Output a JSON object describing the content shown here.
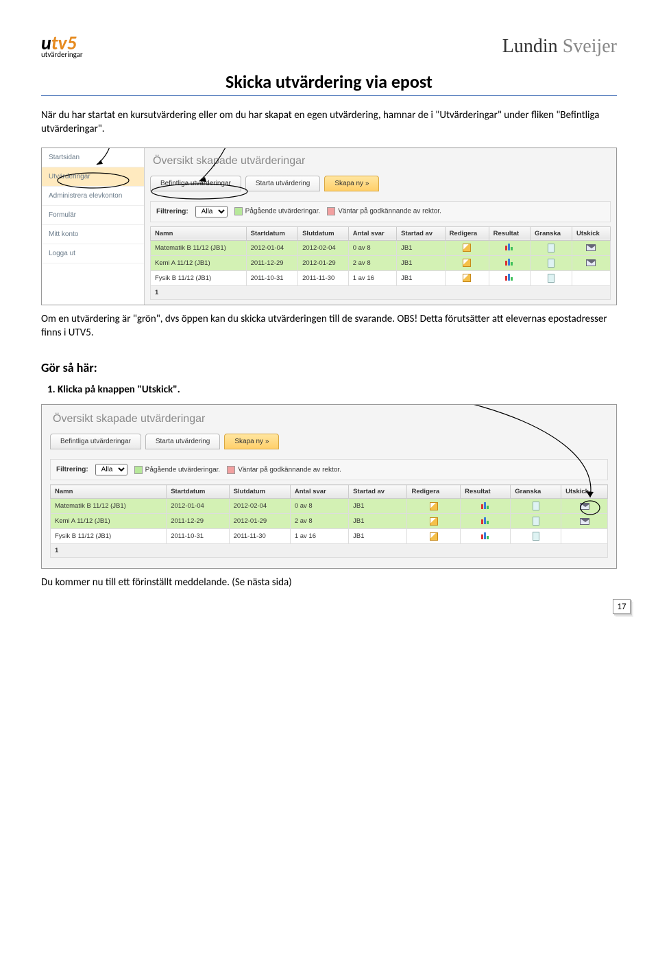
{
  "header": {
    "logo_left_u": "u",
    "logo_left_tv": "tv",
    "logo_left_5": "5",
    "logo_left_sub": "utvärderingar",
    "logo_right_a": "Lundin ",
    "logo_right_b": "Sveijer"
  },
  "title": "Skicka utvärdering via epost",
  "intro": "När du har startat en kursutvärdering eller om du har skapat en egen utvärdering, hamnar de i \"Utvärderingar\" under fliken \"Befintliga utvärderingar\".",
  "sidebar": {
    "items": [
      "Startsidan",
      "Utvärderingar",
      "Administrera elevkonton",
      "Formulär",
      "Mitt konto",
      "Logga ut"
    ]
  },
  "panel": {
    "title": "Översikt skapade utvärderingar",
    "tabs": {
      "t1": "Befintliga utvärderingar",
      "t2": "Starta utvärdering",
      "t3": "Skapa ny »"
    },
    "filter": {
      "label": "Filtrering:",
      "select": "Alla",
      "legend1": "Pågående utvärderingar.",
      "legend2": "Väntar på godkännande av rektor."
    },
    "columns": [
      "Namn",
      "Startdatum",
      "Slutdatum",
      "Antal svar",
      "Startad av",
      "Redigera",
      "Resultat",
      "Granska",
      "Utskick"
    ],
    "rows": [
      {
        "name": "Matematik B 11/12 (JB1)",
        "start": "2012-01-04",
        "end": "2012-02-04",
        "svar": "0 av 8",
        "av": "JB1",
        "green": true,
        "mail": true
      },
      {
        "name": "Kemi A 11/12 (JB1)",
        "start": "2011-12-29",
        "end": "2012-01-29",
        "svar": "2 av 8",
        "av": "JB1",
        "green": true,
        "mail": true
      },
      {
        "name": "Fysik B 11/12 (JB1)",
        "start": "2011-10-31",
        "end": "2011-11-30",
        "svar": "1 av 16",
        "av": "JB1",
        "green": false,
        "mail": false
      }
    ],
    "footer": "1"
  },
  "para2": "Om en utvärdering är \"grön\", dvs öppen kan du skicka utvärderingen till de svarande. OBS! Detta förutsätter att elevernas epostadresser finns i UTV5.",
  "subhead": "Gör så här:",
  "step1": "Klicka på knappen \"Utskick\".",
  "para3": "Du kommer nu till ett förinställt meddelande. (Se nästa sida)",
  "page_number": "17"
}
